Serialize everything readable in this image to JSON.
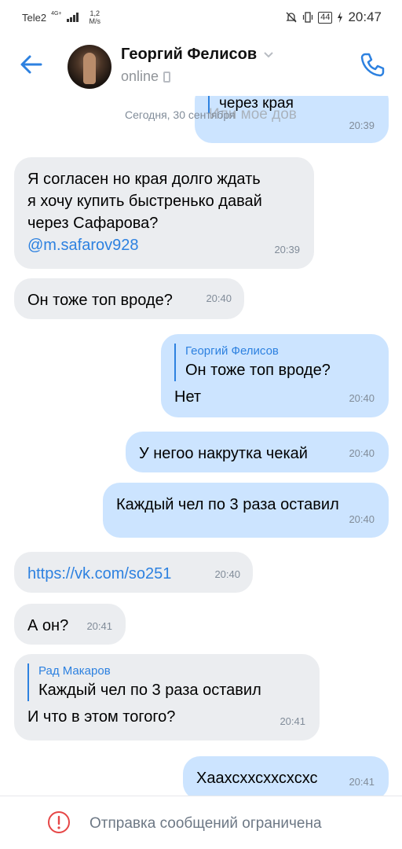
{
  "status_bar": {
    "carrier": "Tele2",
    "network": "4G+",
    "speed_value": "1,2",
    "speed_unit": "M/s",
    "battery": "44",
    "time": "20:47"
  },
  "header": {
    "name": "Георгий Фелисов",
    "status": "online"
  },
  "date_separator": "Сегодня, 30 сентября",
  "messages": [
    {
      "side": "out",
      "reply_name": "",
      "reply_text": "через края",
      "text": "Или мое дов",
      "time": "20:39"
    },
    {
      "side": "in",
      "text_lines": [
        "Я согласен но края долго ждать",
        "я хочу купить быстренько давай",
        "через Сафарова?"
      ],
      "mention": "@m.safarov928",
      "time": "20:39"
    },
    {
      "side": "in",
      "text": "Он тоже топ вроде?",
      "time": "20:40"
    },
    {
      "side": "out",
      "reply_name": "Георгий Фелисов",
      "reply_text": "Он тоже топ вроде?",
      "text": "Нет",
      "time": "20:40"
    },
    {
      "side": "out",
      "text": "У негоо накрутка чекай",
      "time": "20:40"
    },
    {
      "side": "out",
      "text": "Каждый чел по 3 раза оставил",
      "time": "20:40"
    },
    {
      "side": "in",
      "link": "https://vk.com/so251",
      "time": "20:40"
    },
    {
      "side": "in",
      "text": "А он?",
      "time": "20:41"
    },
    {
      "side": "in",
      "reply_name": "Рад Макаров",
      "reply_text": "Каждый чел по 3 раза оставил",
      "text": "И что в этом тогого?",
      "time": "20:41"
    },
    {
      "side": "out",
      "text": "Хаахсххсххсхсхс",
      "time": "20:41"
    }
  ],
  "bottom_bar": {
    "text": "Отправка сообщений ограничена"
  },
  "colors": {
    "accent": "#2d81e0",
    "incoming_bubble": "#ebedf0",
    "outgoing_bubble": "#cce4ff",
    "time_text": "#818c99",
    "warning": "#e64646"
  },
  "icons": [
    "back-arrow-icon",
    "chevron-down-icon",
    "phone-icon",
    "mobile-device-icon",
    "warning-icon",
    "mute-bell-icon",
    "vibrate-icon",
    "charging-icon",
    "signal-bars-icon"
  ]
}
